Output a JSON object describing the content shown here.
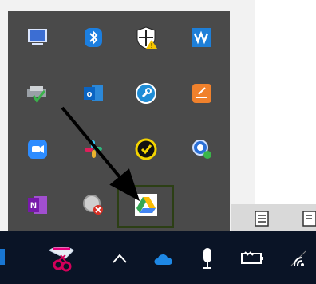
{
  "tray_overflow": {
    "icons": [
      {
        "name": "monitor-icon"
      },
      {
        "name": "bluetooth-icon"
      },
      {
        "name": "windows-security-warning-icon"
      },
      {
        "name": "waves-audio-icon"
      },
      {
        "name": "printer-check-icon"
      },
      {
        "name": "outlook-icon"
      },
      {
        "name": "wrench-circle-icon"
      },
      {
        "name": "sticky-app-icon"
      },
      {
        "name": "zoom-icon"
      },
      {
        "name": "slack-icon"
      },
      {
        "name": "norton-icon"
      },
      {
        "name": "search-sync-icon"
      },
      {
        "name": "onenote-icon"
      },
      {
        "name": "disabled-app-icon"
      },
      {
        "name": "google-drive-icon"
      }
    ]
  },
  "taskbar": {
    "left_icon": "windows-start-icon",
    "snip_icon": "snipping-tool-icon",
    "chevron_label": "^",
    "onedrive_icon": "onedrive-icon",
    "mic_icon": "microphone-icon",
    "battery_icon": "battery-icon",
    "wifi_icon": "wifi-icon"
  },
  "highlight_color": "#2c3f15"
}
